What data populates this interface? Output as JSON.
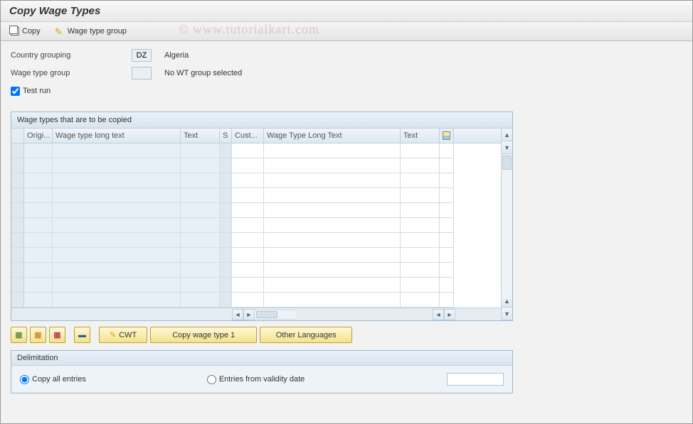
{
  "title": "Copy Wage Types",
  "toolbar": {
    "copy_label": "Copy",
    "wage_type_group_label": "Wage type group"
  },
  "watermark": "© www.tutorialkart.com",
  "form": {
    "country_grouping_label": "Country grouping",
    "country_grouping_value": "DZ",
    "country_grouping_text": "Algeria",
    "wage_type_group_label": "Wage type group",
    "wage_type_group_value": "",
    "wage_type_group_text": "No WT group selected",
    "test_run_label": "Test run"
  },
  "table": {
    "title": "Wage types that are to be copied",
    "headers": {
      "origi": "Origi...",
      "wtlt1": "Wage type long text",
      "text1": "Text",
      "s": "S",
      "cust": "Cust...",
      "wtlt2": "Wage Type Long Text",
      "text2": "Text"
    },
    "row_count": 11
  },
  "buttons": {
    "cwt": "CWT",
    "copy_wage_type_1": "Copy wage type 1",
    "other_languages": "Other Languages"
  },
  "delimitation": {
    "title": "Delimitation",
    "copy_all": "Copy all entries",
    "entries_from": "Entries from validity date",
    "date_value": ""
  }
}
